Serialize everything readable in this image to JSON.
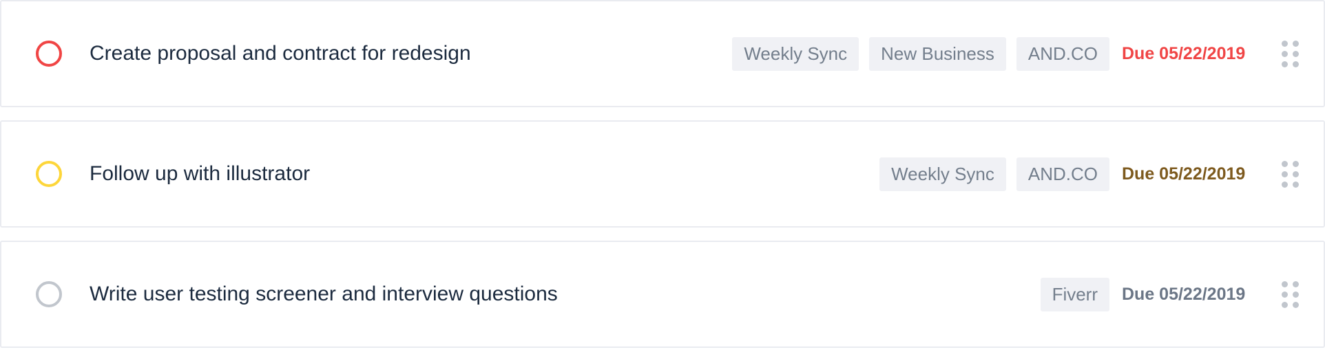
{
  "tasks": [
    {
      "title": "Create proposal and contract for redesign",
      "tags": [
        "Weekly Sync",
        "New Business",
        "AND.CO"
      ],
      "due": "Due 05/22/2019",
      "status_color": "#f04545",
      "due_color": "#f04545"
    },
    {
      "title": "Follow up with illustrator",
      "tags": [
        "Weekly Sync",
        "AND.CO"
      ],
      "due": "Due 05/22/2019",
      "status_color": "#fdd63a",
      "due_color": "#7d5a1e"
    },
    {
      "title": "Write user testing screener and interview questions",
      "tags": [
        "Fiverr"
      ],
      "due": "Due 05/22/2019",
      "status_color": "#c1c6cd",
      "due_color": "#6b7686"
    }
  ],
  "icons": {
    "check": "circle-outline",
    "handle": "drag-handle-dots"
  }
}
